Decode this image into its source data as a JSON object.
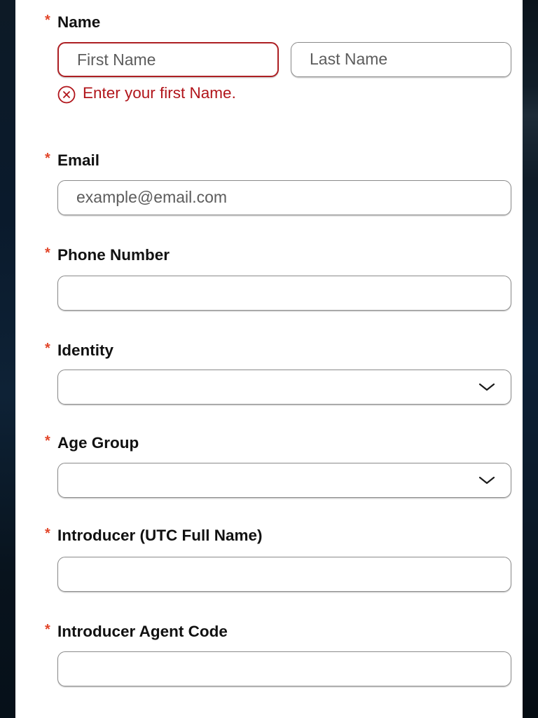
{
  "form": {
    "name": {
      "label": "Name",
      "required_mark": "*",
      "first_placeholder": "First Name",
      "last_placeholder": "Last Name",
      "error": "Enter your first Name."
    },
    "email": {
      "label": "Email",
      "required_mark": "*",
      "placeholder": "example@email.com"
    },
    "phone": {
      "label": "Phone Number",
      "required_mark": "*",
      "value": ""
    },
    "identity": {
      "label": "Identity",
      "required_mark": "*",
      "selected": ""
    },
    "age_group": {
      "label": "Age Group",
      "required_mark": "*",
      "selected": ""
    },
    "introducer": {
      "label": "Introducer (UTC Full Name)",
      "required_mark": "*",
      "value": ""
    },
    "agent_code": {
      "label": "Introducer Agent Code",
      "required_mark": "*",
      "value": ""
    }
  },
  "icons": {
    "error": "error-circle-x-icon",
    "dropdown": "chevron-down-icon"
  },
  "colors": {
    "required": "#e2462a",
    "error": "#b1151b",
    "border": "#8a8a8a"
  }
}
